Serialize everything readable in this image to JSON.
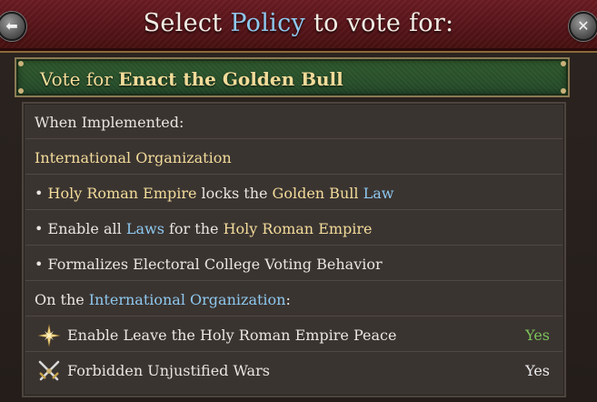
{
  "header": {
    "title_before": "Select ",
    "title_highlight": "Policy",
    "title_after": " to vote for:",
    "back_glyph": "⬅",
    "close_glyph": "✕"
  },
  "banner": {
    "prefix": "Vote for ",
    "policy": "Enact the Golden Bull"
  },
  "rows": {
    "when_implemented": "When Implemented:",
    "org_type": "International Organization",
    "effect1": {
      "bullet": "• ",
      "subject": "Holy Roman Empire",
      "mid": " locks the ",
      "object": "Golden Bull",
      "space": " ",
      "link": "Law"
    },
    "effect2": {
      "bullet": "• Enable all ",
      "link": "Laws",
      "mid": " for the ",
      "object": "Holy Roman Empire"
    },
    "effect3": "• Formalizes Electoral College Voting Behavior",
    "on_org": {
      "prefix": "On the ",
      "link": "International Organization",
      "suffix": ":"
    },
    "perm1": {
      "icon": "star-burst-icon",
      "label": "Enable Leave the Holy Roman Empire Peace",
      "value": "Yes"
    },
    "perm2": {
      "icon": "crossed-swords-icon",
      "label": "Forbidden Unjustified Wars",
      "value": "Yes"
    }
  },
  "colors": {
    "header_red": "#561419",
    "banner_green": "#2f5a2c",
    "gold_text": "#f3dc9a",
    "link_blue": "#8ec8ee",
    "yes_green": "#7cc35a"
  }
}
